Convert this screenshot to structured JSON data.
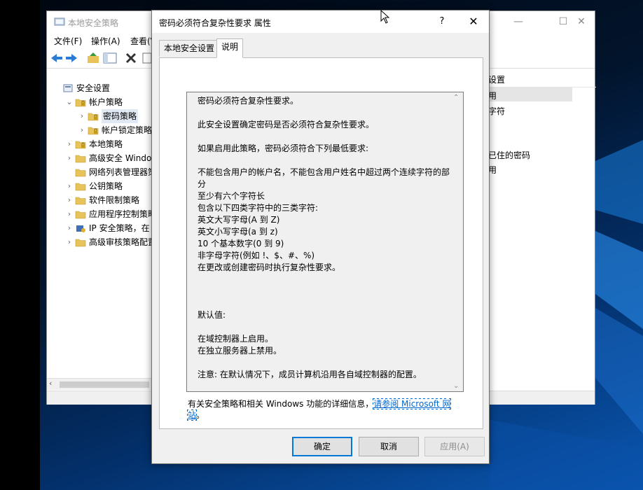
{
  "background_window": {
    "title": "本地安全策略",
    "menu": [
      "文件(F)",
      "操作(A)",
      "查看(V"
    ],
    "tree": [
      {
        "label": "安全设置",
        "level": 0,
        "expanded": "none",
        "icon": "security-settings-icon"
      },
      {
        "label": "帐户策略",
        "level": 1,
        "expanded": "down",
        "icon": "folder-lock-icon"
      },
      {
        "label": "密码策略",
        "level": 2,
        "expanded": "right",
        "icon": "folder-lock-icon",
        "selected": true
      },
      {
        "label": "帐户锁定策略",
        "level": 2,
        "expanded": "right",
        "icon": "folder-lock-icon"
      },
      {
        "label": "本地策略",
        "level": 1,
        "expanded": "right",
        "icon": "folder-lock-icon"
      },
      {
        "label": "高级安全 Windows",
        "level": 1,
        "expanded": "right",
        "icon": "folder-icon"
      },
      {
        "label": "网络列表管理器策略",
        "level": 1,
        "expanded": "none",
        "icon": "folder-icon"
      },
      {
        "label": "公钥策略",
        "level": 1,
        "expanded": "right",
        "icon": "folder-icon"
      },
      {
        "label": "软件限制策略",
        "level": 1,
        "expanded": "right",
        "icon": "folder-icon"
      },
      {
        "label": "应用程序控制策略",
        "level": 1,
        "expanded": "right",
        "icon": "folder-icon"
      },
      {
        "label": "IP 安全策略，在 本地",
        "level": 1,
        "expanded": "right",
        "icon": "ip-security-icon"
      },
      {
        "label": "高级审核策略配置",
        "level": 1,
        "expanded": "right",
        "icon": "folder-icon"
      }
    ],
    "right_pane": {
      "header": "设置",
      "rows": [
        "用",
        "字符",
        "",
        "",
        "已住的密码",
        "用"
      ]
    }
  },
  "dialog": {
    "title": "密码必须符合复杂性要求 属性",
    "help_glyph": "?",
    "close_glyph": "✕",
    "tabs": [
      "本地安全设置",
      "说明"
    ],
    "active_tab": "说明",
    "explain_text": "密码必须符合复杂性要求。\n\n此安全设置确定密码是否必须符合复杂性要求。\n\n如果启用此策略，密码必须符合下列最低要求:\n\n不能包含用户的帐户名，不能包含用户姓名中超过两个连续字符的部分\n至少有六个字符长\n包含以下四类字符中的三类字符:\n英文大写字母(A 到 Z)\n英文小写字母(a 到 z)\n10 个基本数字(0 到 9)\n非字母字符(例如 !、$、#、%)\n在更改或创建密码时执行复杂性要求。\n\n\n\n默认值:\n\n在域控制器上启用。\n在独立服务器上禁用。\n\n注意: 在默认情况下，成员计算机沿用各自域控制器的配置。",
    "info_text": "有关安全策略和相关 Windows 功能的详细信息，",
    "info_link": "请参阅 Microsoft 网站",
    "info_suffix": "。",
    "buttons": {
      "ok": "确定",
      "cancel": "取消",
      "apply": "应用(A)"
    }
  },
  "colors": {
    "link": "#0066cc",
    "default_button_border": "#0078d7",
    "selection": "#dfe8f3"
  }
}
